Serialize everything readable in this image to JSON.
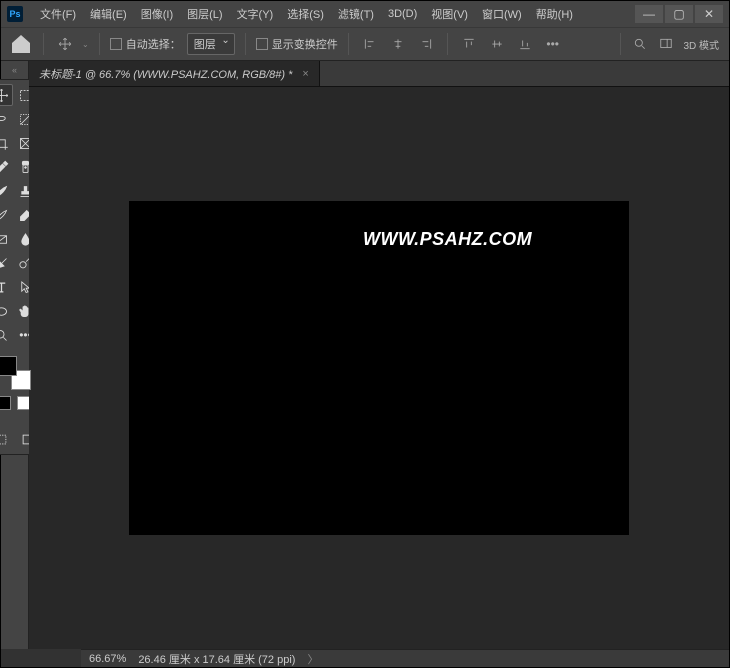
{
  "menu": {
    "file": "文件(F)",
    "edit": "编辑(E)",
    "image": "图像(I)",
    "layer": "图层(L)",
    "type": "文字(Y)",
    "select": "选择(S)",
    "filter": "滤镜(T)",
    "threeD": "3D(D)",
    "view": "视图(V)",
    "window": "窗口(W)",
    "help": "帮助(H)"
  },
  "options": {
    "autoSelect": "自动选择：",
    "ddValue": "图层",
    "showTransform": "显示变换控件",
    "mode3d": "3D 模式"
  },
  "tab": {
    "title": "未标题-1 @ 66.7% (WWW.PSAHZ.COM, RGB/8#) *"
  },
  "canvas": {
    "text": "WWW.PSAHZ.COM"
  },
  "status": {
    "zoom": "66.67%",
    "dims": "26.46 厘米 x 17.64 厘米 (72 ppi)"
  }
}
